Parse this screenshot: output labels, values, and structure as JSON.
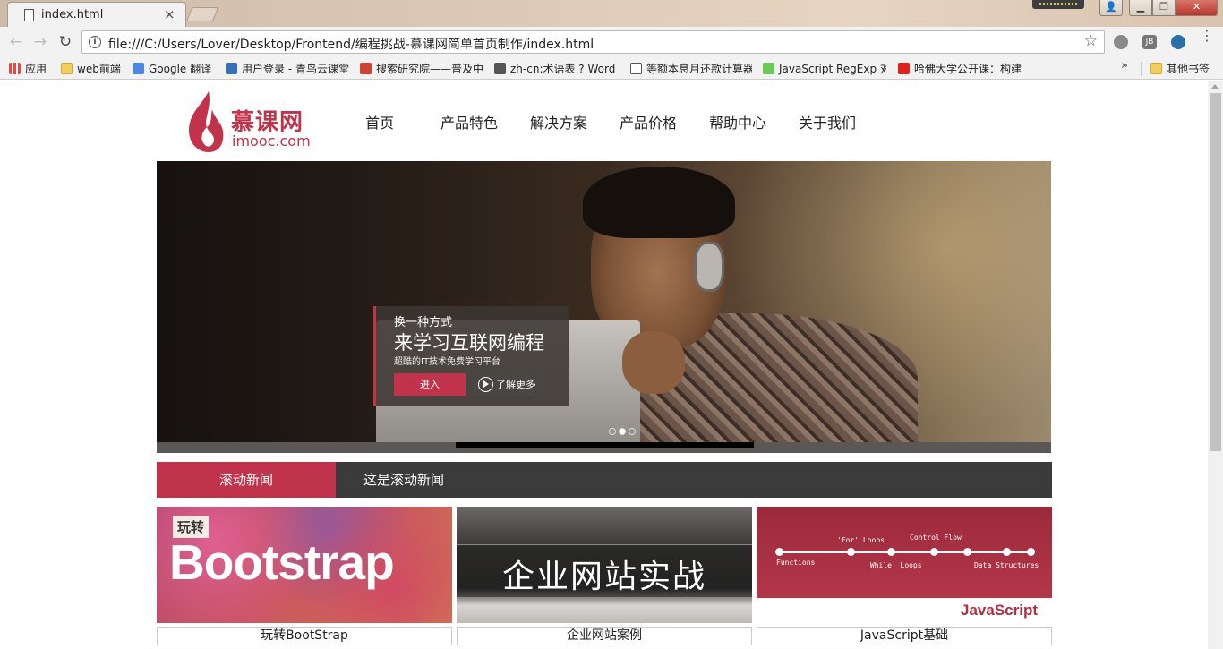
{
  "browser": {
    "tab_title": "index.html",
    "tab_close": "×",
    "url": "file:///C:/Users/Lover/Desktop/Frontend/编程挑战-慕课网简单首页制作/index.html",
    "info_icon": "i",
    "star": "☆",
    "back": "←",
    "forward": "→",
    "reload": "↻",
    "ext1": "",
    "ext2": "JB",
    "ext3": "",
    "menu": "⋮",
    "win_user": "👤",
    "win_min": "▁",
    "win_max": "❐",
    "win_close": "✕"
  },
  "bookmarks": {
    "items": [
      {
        "label": "应用",
        "icon": "apps-icon"
      },
      {
        "label": "web前端",
        "icon": "folder-icon"
      },
      {
        "label": "Google 翻译",
        "icon": "google-translate-icon"
      },
      {
        "label": "用户登录 - 青鸟云课堂",
        "icon": "site-icon"
      },
      {
        "label": "搜索研究院——普及中",
        "icon": "site-icon"
      },
      {
        "label": "zh-cn:术语表 ? WordP",
        "icon": "wordpress-icon"
      },
      {
        "label": "等额本息月还款计算器",
        "icon": "page-icon"
      },
      {
        "label": "JavaScript RegExp 对",
        "icon": "regex-icon"
      },
      {
        "label": "哈佛大学公开课：构建",
        "icon": "weibo-icon"
      }
    ],
    "more": "»",
    "other": "其他书签"
  },
  "site": {
    "logo_cn": "慕课网",
    "logo_en": "imooc.com",
    "nav": [
      "首页",
      "产品特色",
      "解决方案",
      "产品价格",
      "帮助中心",
      "关于我们"
    ],
    "banner": {
      "small": "换一种方式",
      "big": "来学习互联网编程",
      "sub": "超酷的IT技术免费学习平台",
      "enter": "进入",
      "more": "了解更多",
      "active_slide": 2,
      "slide_count": 3
    },
    "news": {
      "label": "滚动新闻",
      "text": "这是滚动新闻"
    },
    "courses": [
      {
        "tag": "玩转",
        "word": "Bootstrap",
        "caption": "玩转BootStrap"
      },
      {
        "banner_text": "企业网站实战",
        "caption": "企业网站案例"
      },
      {
        "labels": [
          "Functions",
          "'For' Loops",
          "'While' Loops",
          "Control Flow",
          "Data Structures"
        ],
        "word": "JavaScript",
        "caption": "JavaScript基础"
      }
    ]
  },
  "colors": {
    "brand": "#c0334a",
    "news_bar": "#3b3b3b"
  }
}
